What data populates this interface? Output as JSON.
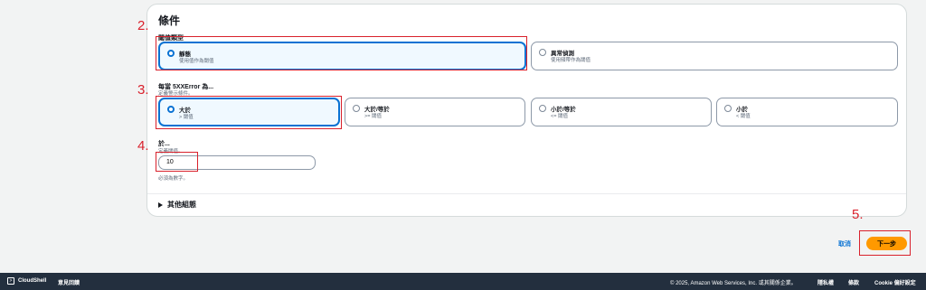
{
  "panel": {
    "title": "條件",
    "threshold_type": {
      "label": "閾值類型",
      "options": [
        {
          "title": "靜態",
          "desc": "使用值作為閾值",
          "selected": true
        },
        {
          "title": "異常偵測",
          "desc": "使用頻帶作為閾值",
          "selected": false
        }
      ]
    },
    "comparison": {
      "label": "每當 5XXError 為...",
      "desc": "定義警示條件。",
      "options": [
        {
          "title": "大於",
          "desc": "> 閾值",
          "selected": true
        },
        {
          "title": "大於/等於",
          "desc": ">= 閾值",
          "selected": false
        },
        {
          "title": "小於/等於",
          "desc": "<= 閾值",
          "selected": false
        },
        {
          "title": "小於",
          "desc": "< 閾值",
          "selected": false
        }
      ]
    },
    "threshold": {
      "label": "於...",
      "desc": "定義閾值。",
      "value": "10",
      "hint": "必須為數字。"
    },
    "additional": {
      "label": "其他組態"
    }
  },
  "annotations": [
    "2.",
    "3.",
    "4.",
    "5."
  ],
  "actions": {
    "cancel": "取消",
    "next": "下一步"
  },
  "footer": {
    "cloudshell": "CloudShell",
    "feedback": "意見回饋",
    "copyright": "© 2025, Amazon Web Services, Inc. 或其關係企業。",
    "privacy": "隱私權",
    "terms": "條款",
    "cookies": "Cookie 偏好設定"
  },
  "colors": {
    "accent": "#0972d3",
    "primary_button": "#ff9900",
    "annotation": "#d9212c",
    "footer_bg": "#232f3e"
  }
}
